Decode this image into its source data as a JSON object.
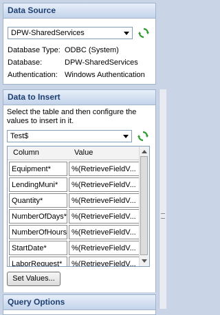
{
  "data_source": {
    "title": "Data Source",
    "connection": "DPW-SharedServices",
    "fields": [
      {
        "label": "Database Type:",
        "value": "ODBC (System)"
      },
      {
        "label": "Database:",
        "value": "DPW-SharedServices"
      },
      {
        "label": "Authentication:",
        "value": "Windows Authentication"
      }
    ]
  },
  "data_to_insert": {
    "title": "Data to Insert",
    "instructions_line1": "Select the table and then configure the",
    "instructions_line2": "values to insert in it.",
    "table": "Test$",
    "columns_header": "Column",
    "value_header": "Value",
    "rows": [
      {
        "column": "Equipment*",
        "value": "%(RetrieveFieldV..."
      },
      {
        "column": "LendingMuni*",
        "value": "%(RetrieveFieldV..."
      },
      {
        "column": "Quantity*",
        "value": "%(RetrieveFieldV..."
      },
      {
        "column": "NumberOfDays*",
        "value": "%(RetrieveFieldV..."
      },
      {
        "column": "NumberOfHours*",
        "value": "%(RetrieveFieldV..."
      },
      {
        "column": "StartDate*",
        "value": "%(RetrieveFieldV..."
      },
      {
        "column": "LaborRequest*",
        "value": "%(RetrieveFieldV..."
      }
    ],
    "set_values_label": "Set Values..."
  },
  "query_options": {
    "title": "Query Options"
  },
  "colors": {
    "header_text": "#1e3f74",
    "refresh_green": "#2e9b2e",
    "background": "#c9d5e6"
  }
}
